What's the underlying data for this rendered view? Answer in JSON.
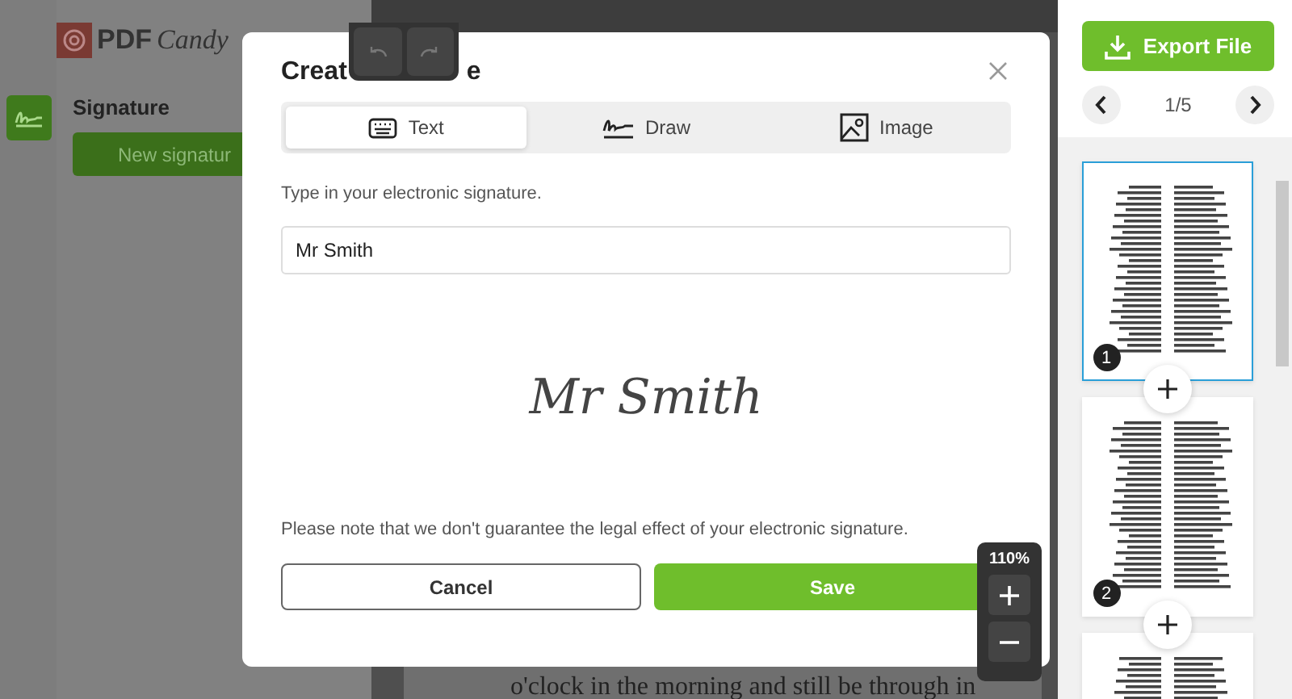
{
  "sidebar": {
    "logo_bold": "PDF",
    "logo_script": "Candy",
    "tool_label": "Signature",
    "new_button": "New signatur"
  },
  "document": {
    "visible_line": "o'clock in the morning and still be through in"
  },
  "modal": {
    "title_parts": [
      "Creat",
      "e"
    ],
    "tabs": [
      {
        "label": "Text",
        "kind": "keyboard",
        "selected": true
      },
      {
        "label": "Draw",
        "kind": "draw",
        "selected": false
      },
      {
        "label": "Image",
        "kind": "image",
        "selected": false
      }
    ],
    "instruction": "Type in your electronic signature.",
    "input_value": "Mr Smith",
    "preview": "Mr Smith",
    "note": "Please note that we don't guarantee the legal effect of your electronic signature.",
    "buttons": [
      {
        "label": "Cancel",
        "kind": "secondary"
      },
      {
        "label": "Save",
        "kind": "primary"
      }
    ]
  },
  "zoom": {
    "value": "110%"
  },
  "right_panel": {
    "export": "Export File",
    "page_indicator": "1/5",
    "thumbnails": [
      {
        "number": "1",
        "selected": true
      },
      {
        "number": "2",
        "selected": false
      },
      {
        "selected": false
      }
    ]
  }
}
